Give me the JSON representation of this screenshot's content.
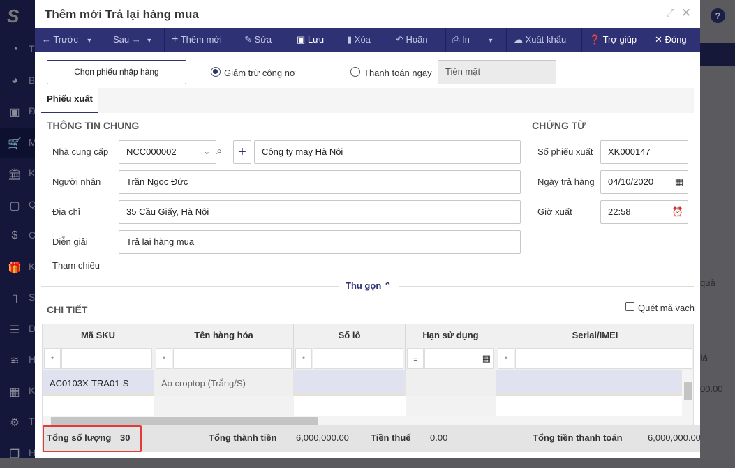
{
  "sidebar": {
    "items": [
      {
        "icon": "dashboard-icon",
        "letter": "T"
      },
      {
        "icon": "pie-chart-icon",
        "letter": "B"
      },
      {
        "icon": "truck-icon",
        "letter": "Đ"
      },
      {
        "icon": "cart-icon",
        "letter": "M"
      },
      {
        "icon": "bank-icon",
        "letter": "K"
      },
      {
        "icon": "safe-icon",
        "letter": "Q"
      },
      {
        "icon": "money-bag-icon",
        "letter": "C"
      },
      {
        "icon": "gift-icon",
        "letter": "K"
      },
      {
        "icon": "tablet-icon",
        "letter": "S"
      },
      {
        "icon": "list-icon",
        "letter": "D"
      },
      {
        "icon": "layers-icon",
        "letter": "H"
      },
      {
        "icon": "calculator-icon",
        "letter": "K"
      },
      {
        "icon": "gear-icon",
        "letter": "T"
      },
      {
        "icon": "boxes-icon",
        "letter": "H"
      }
    ]
  },
  "background": {
    "help": "?",
    "text_qua": "quả",
    "text_gia": "iá",
    "text_amount": "00.00"
  },
  "modal": {
    "title": "Thêm mới Trả lại hàng mua",
    "toolbar": {
      "prev": "Trước",
      "next": "Sau",
      "add": "Thêm mới",
      "edit": "Sửa",
      "save": "Lưu",
      "delete": "Xóa",
      "undo": "Hoãn",
      "print": "In",
      "export": "Xuất khẩu",
      "help": "Trợ giúp",
      "close": "Đóng"
    },
    "choose_receipt": "Chọn phiếu nhập hàng",
    "radio_debt": "Giảm trừ công nợ",
    "radio_pay": "Thanh toán ngay",
    "payment_method": "Tiền mặt",
    "tab": "Phiếu xuất",
    "general": {
      "heading": "THÔNG TIN CHUNG",
      "supplier_label": "Nhà cung cấp",
      "supplier_code": "NCC000002",
      "supplier_name": "Công ty may Hà Nội",
      "receiver_label": "Người nhận",
      "receiver": "Trần Ngọc Đức",
      "address_label": "Địa chỉ",
      "address": "35 Cầu Giấy, Hà Nội",
      "desc_label": "Diễn giải",
      "desc": "Trả lại hàng mua",
      "ref_label": "Tham chiếu"
    },
    "voucher": {
      "heading": "CHỨNG TỪ",
      "no_label": "Số phiếu xuất",
      "no": "XK000147",
      "date_label": "Ngày trả hàng",
      "date": "04/10/2020",
      "time_label": "Giờ xuất",
      "time": "22:58"
    },
    "collapse": "Thu gọn",
    "detail": {
      "heading": "CHI TIẾT",
      "scan": "Quét mã vạch",
      "columns": [
        "Mã SKU",
        "Tên hàng hóa",
        "Số lô",
        "Hạn sử dụng",
        "Serial/IMEI"
      ],
      "filter_ops": [
        "*",
        "*",
        "*",
        "=",
        "*"
      ],
      "rows": [
        [
          "AC0103X-TRA01-S",
          "Áo croptop (Trắng/S)",
          "",
          "",
          ""
        ]
      ]
    },
    "footer": {
      "qty_label": "Tổng số lượng",
      "qty": "30",
      "amount_label": "Tổng thành tiền",
      "amount": "6,000,000.00",
      "tax_label": "Tiền thuế",
      "tax": "0.00",
      "total_label": "Tổng tiền thanh toán",
      "total": "6,000,000.00"
    }
  }
}
